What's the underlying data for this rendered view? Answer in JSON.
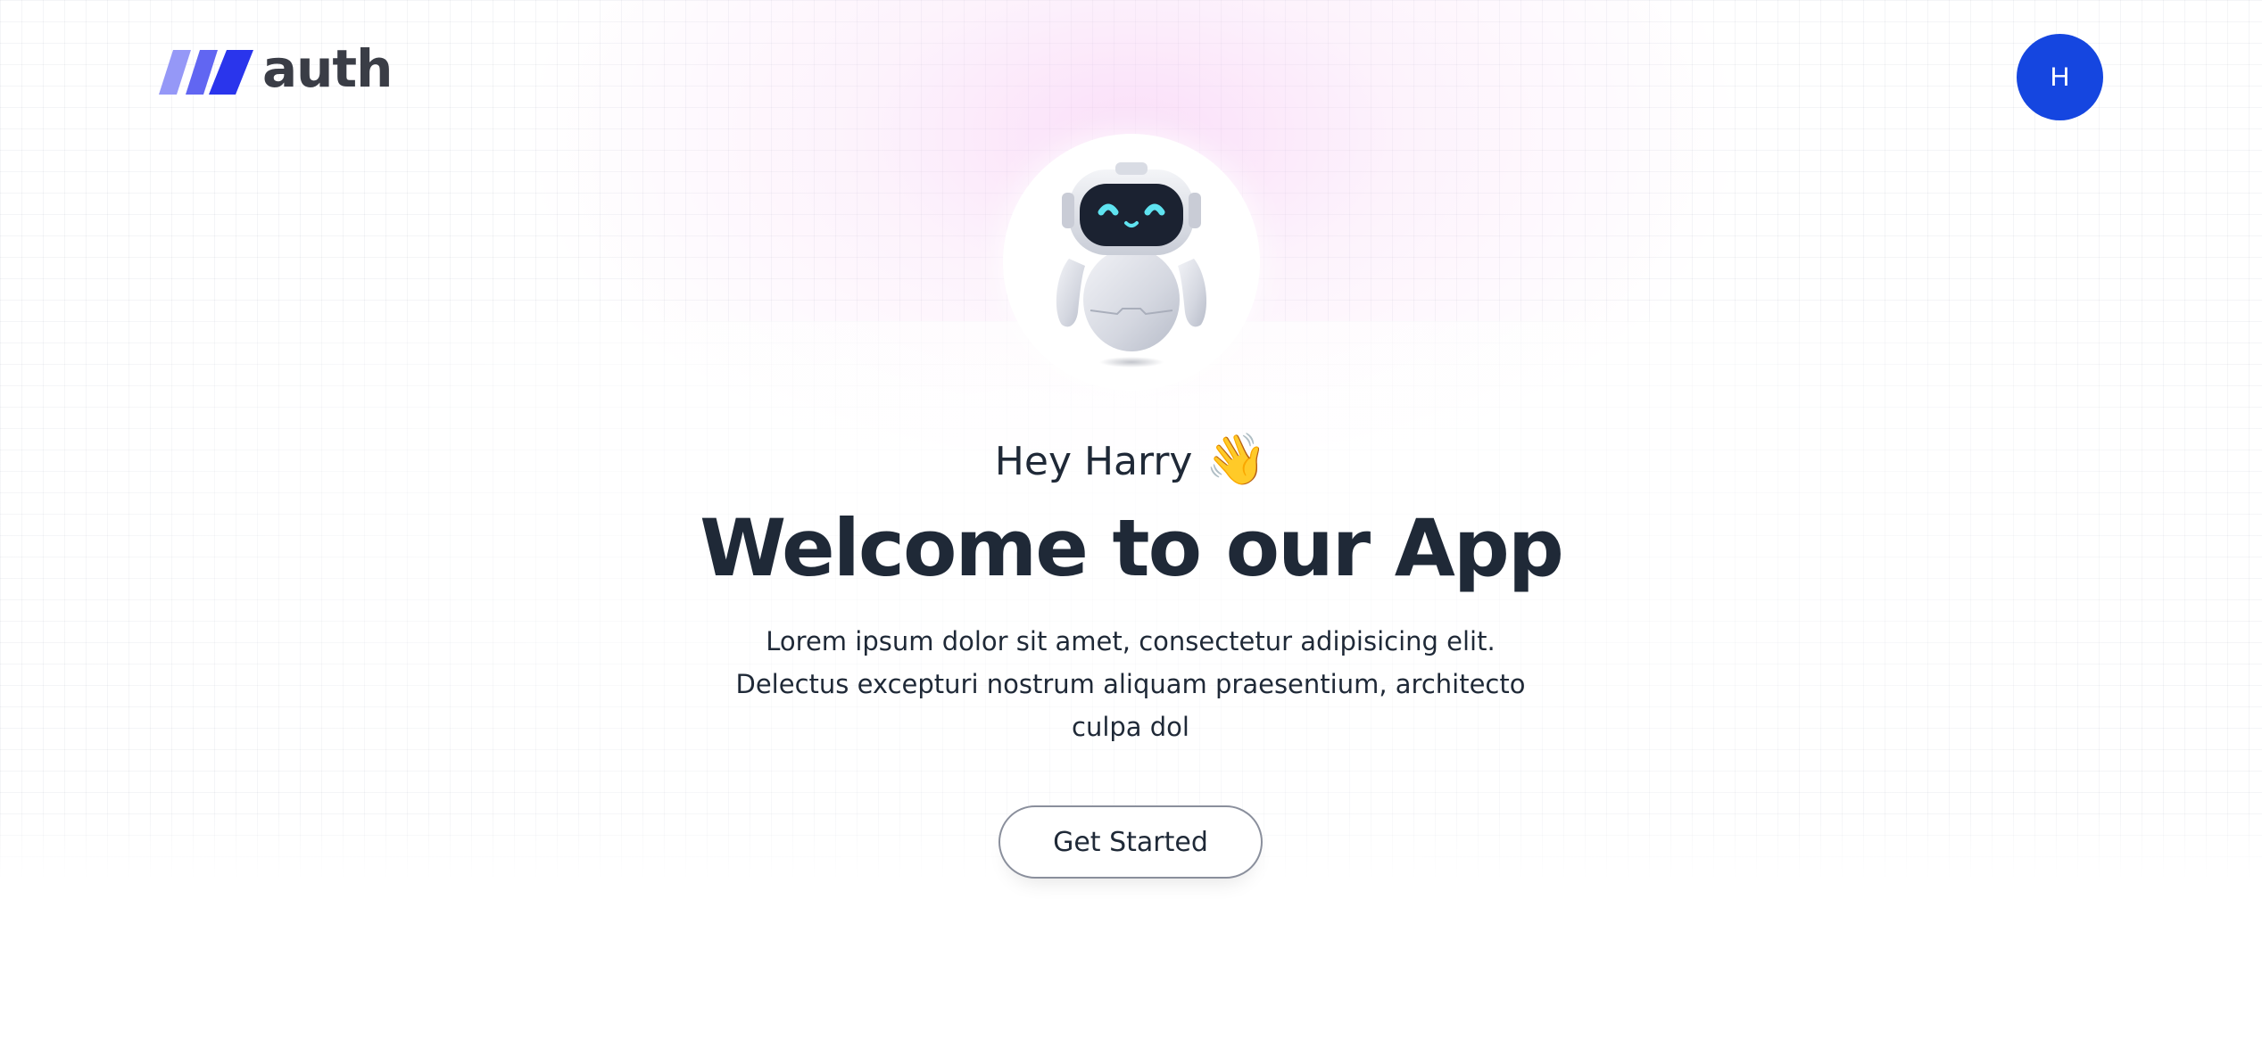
{
  "header": {
    "logo_text": "auth",
    "avatar_initial": "H"
  },
  "hero": {
    "greeting": "Hey Harry",
    "greeting_emoji": "👋",
    "headline": "Welcome to our App",
    "description": "Lorem ipsum dolor sit amet, consectetur adipisicing elit. Delectus excepturi nostrum aliquam praesentium, architecto culpa dol",
    "cta_label": "Get Started"
  },
  "icons": {
    "logo_mark": "triple-slash-logo-icon",
    "avatar": "user-avatar",
    "robot": "robot-illustration"
  },
  "colors": {
    "avatar_bg": "#1546e0",
    "logo_mark_light": "#8f93f7",
    "logo_mark_mid": "#6166f2",
    "logo_mark_dark": "#2a35ec",
    "text_primary": "#1f2937",
    "robot_eyes": "#5fe3f0"
  }
}
